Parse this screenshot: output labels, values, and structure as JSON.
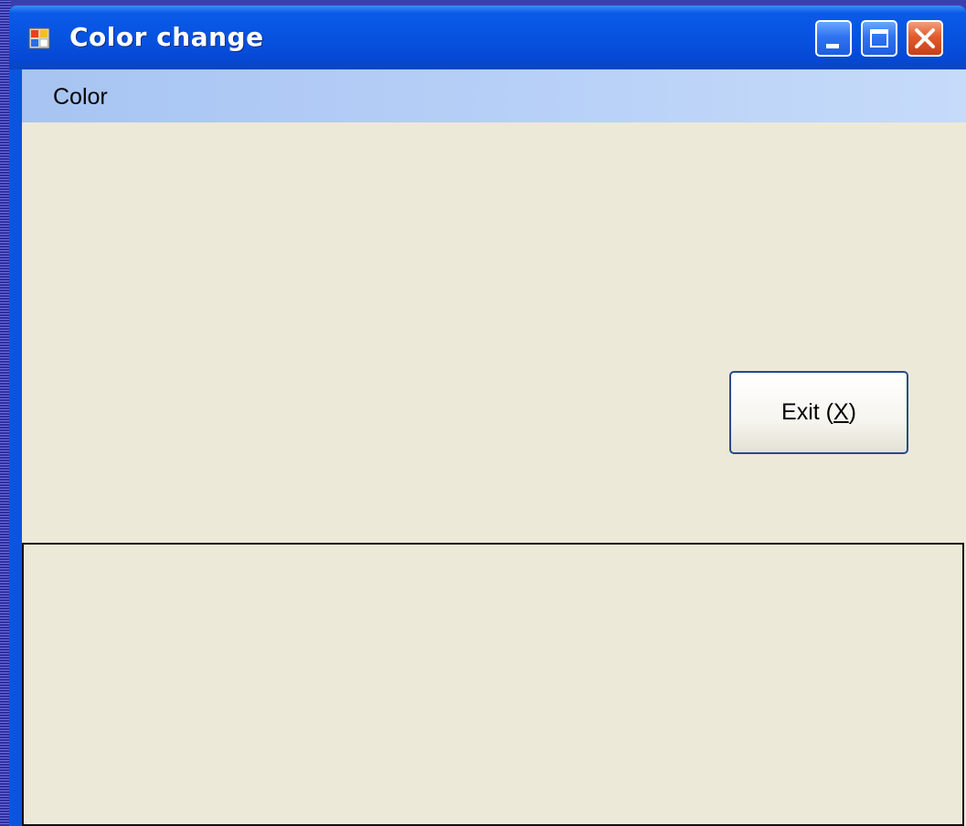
{
  "window": {
    "title": "Color change",
    "icon": "app-window-icon"
  },
  "titlebar_buttons": {
    "minimize": "minimize-icon",
    "maximize": "maximize-icon",
    "close": "close-icon"
  },
  "menubar": {
    "items": [
      {
        "label": "Color"
      }
    ]
  },
  "main": {
    "exit_button": {
      "label_prefix": "Exit (",
      "mnemonic": "X",
      "label_suffix": ")"
    }
  },
  "colors": {
    "titlebar": "#0653e0",
    "client_background": "#ece9d8",
    "menubar": "#b6cff7",
    "close_button": "#e35a2a"
  }
}
